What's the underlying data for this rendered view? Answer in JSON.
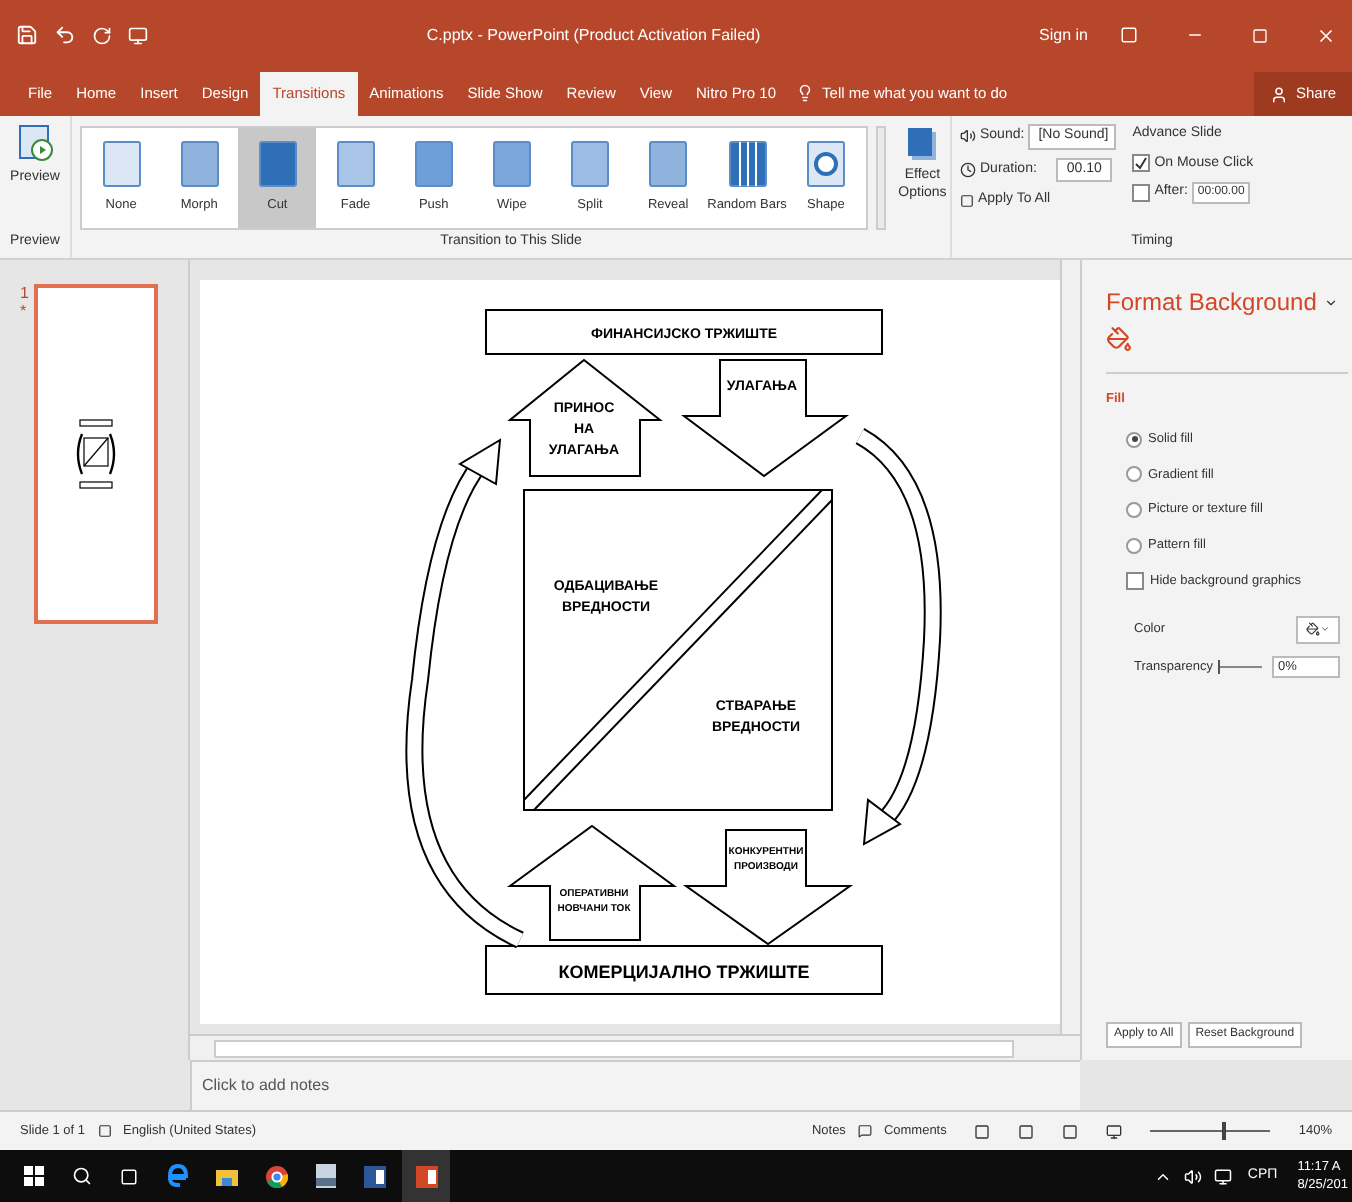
{
  "title_bar": {
    "title": "C.pptx - PowerPoint (Product Activation Failed)",
    "sign_in": "Sign in"
  },
  "tabs": [
    {
      "label": "File",
      "selected": false
    },
    {
      "label": "Home",
      "selected": false
    },
    {
      "label": "Insert",
      "selected": false
    },
    {
      "label": "Design",
      "selected": false
    },
    {
      "label": "Transitions",
      "selected": true
    },
    {
      "label": "Animations",
      "selected": false
    },
    {
      "label": "Slide Show",
      "selected": false
    },
    {
      "label": "Review",
      "selected": false
    },
    {
      "label": "View",
      "selected": false
    },
    {
      "label": "Nitro Pro 10",
      "selected": false
    }
  ],
  "tell_me": "Tell me what you want to do",
  "share": "Share",
  "ribbon": {
    "preview": "Preview",
    "transitions": [
      {
        "label": "None",
        "selected": false
      },
      {
        "label": "Morph",
        "selected": false
      },
      {
        "label": "Cut",
        "selected": true
      },
      {
        "label": "Fade",
        "selected": false
      },
      {
        "label": "Push",
        "selected": false
      },
      {
        "label": "Wipe",
        "selected": false
      },
      {
        "label": "Split",
        "selected": false
      },
      {
        "label": "Reveal",
        "selected": false
      },
      {
        "label": "Random Bars",
        "selected": false
      },
      {
        "label": "Shape",
        "selected": false
      }
    ],
    "effect_options": "Effect Options",
    "sound_label": "Sound:",
    "sound_value": "[No Sound]",
    "duration_label": "Duration:",
    "duration_value": "00.10",
    "apply_all": "Apply To All",
    "advance_title": "Advance Slide",
    "on_mouse_click": {
      "label": "On Mouse Click",
      "checked": true
    },
    "after": {
      "label": "After:",
      "checked": false,
      "value": "00:00.00"
    },
    "groups": [
      "Preview",
      "Transition to This Slide",
      "Timing"
    ]
  },
  "thumbnails": [
    {
      "number": "1",
      "star": "*",
      "selected": true
    }
  ],
  "slide": {
    "top_market": "ФИНАНСИЈСКО ТРЖИШТЕ",
    "return_lines": [
      "ПРИНОС",
      "НА",
      "УЛАГАЊА"
    ],
    "investment": "УЛАГАЊА",
    "discard_lines": [
      "ОДБАЦИВАЊЕ",
      "ВРЕДНОСТИ"
    ],
    "create_lines": [
      "СТВАРАЊЕ",
      "ВРЕДНОСТИ"
    ],
    "cash_flow_lines": [
      "ОПЕРАТИВНИ",
      "НОВЧАНИ ТОК"
    ],
    "competitors_lines": [
      "КОНКУРЕНТНИ",
      "ПРОИЗВОДИ"
    ],
    "bottom_market": "КОМЕРЦИЈАЛНО ТРЖИШТЕ"
  },
  "notes_placeholder": "Click to add notes",
  "format_pane": {
    "title": "Format Background",
    "section": "Fill",
    "options": [
      {
        "kind": "radio",
        "label": "Solid fill",
        "selected": true
      },
      {
        "kind": "radio",
        "label": "Gradient fill",
        "selected": false
      },
      {
        "kind": "radio",
        "label": "Picture or texture fill",
        "selected": false
      },
      {
        "kind": "radio",
        "label": "Pattern fill",
        "selected": false
      },
      {
        "kind": "checkbox",
        "label": "Hide background graphics",
        "checked": false
      }
    ],
    "color_label": "Color",
    "transparency_label": "Transparency",
    "transparency": {
      "value": "0%",
      "level": 0
    },
    "buttons": [
      "Apply to All",
      "Reset Background"
    ]
  },
  "status_bar": {
    "slide": "Slide 1 of 1",
    "language": "English (United States)",
    "notes": "Notes",
    "comments": "Comments",
    "zoom": {
      "value": "140%",
      "level": 0.62
    }
  },
  "taskbar": {
    "input_language": "СРП",
    "time": "11:17 A",
    "date": "8/25/201"
  }
}
